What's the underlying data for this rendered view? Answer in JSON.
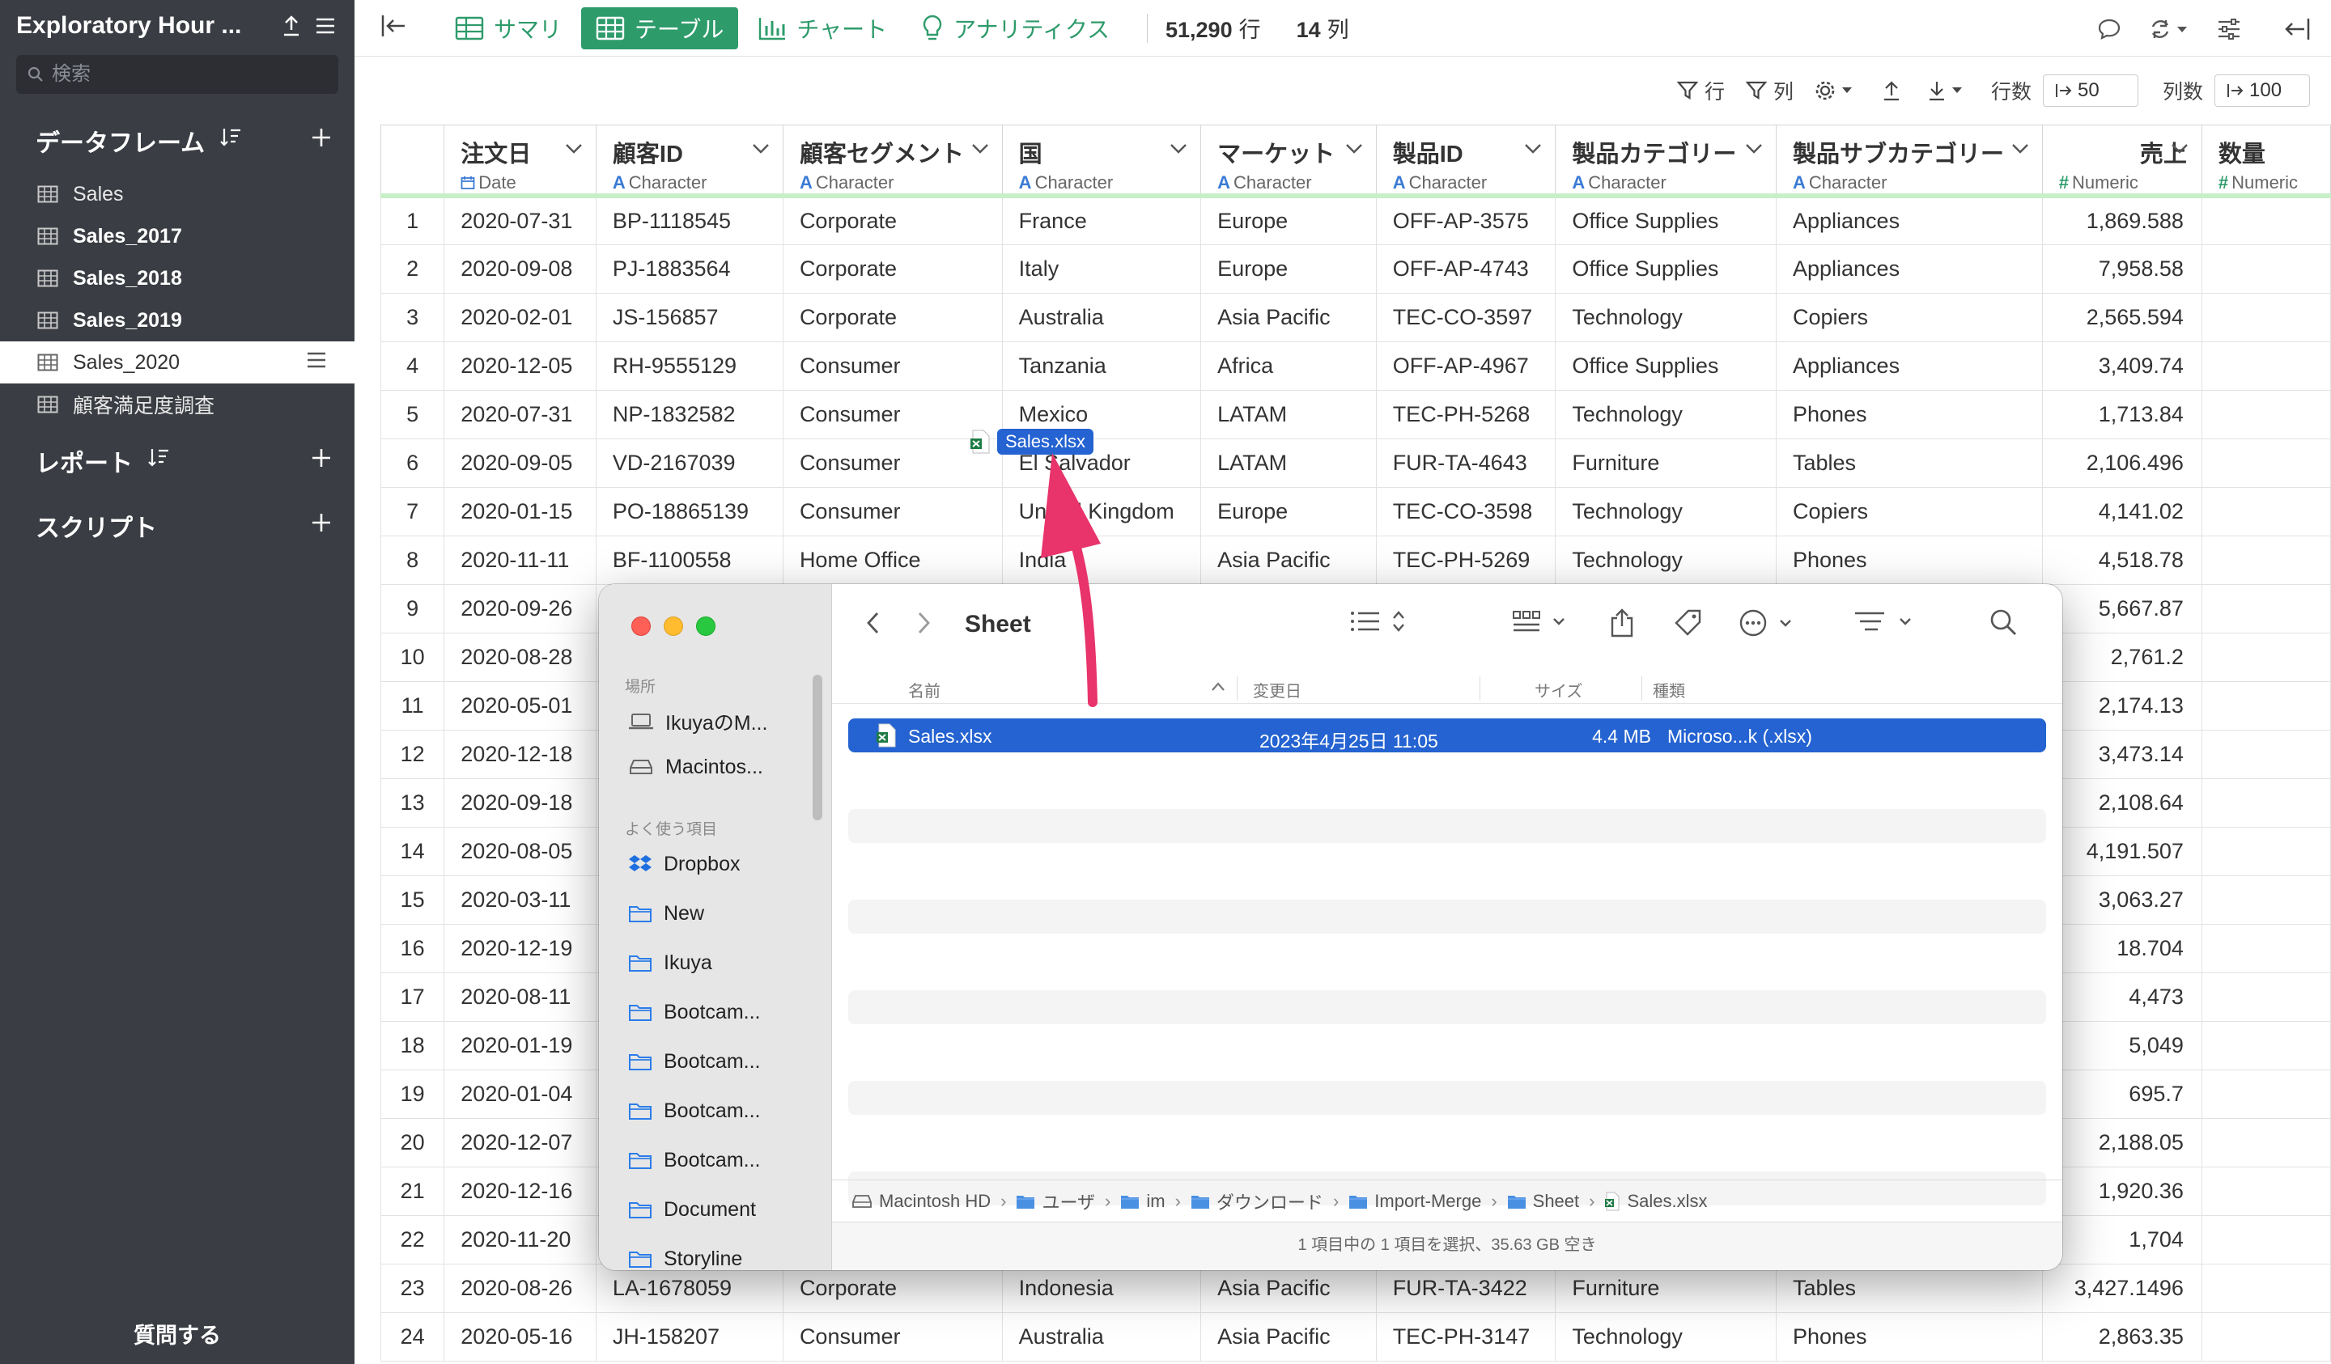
{
  "sidebar": {
    "title": "Exploratory Hour ...",
    "search_placeholder": "検索",
    "sections": {
      "dataframes": "データフレーム",
      "reports": "レポート",
      "scripts": "スクリプト"
    },
    "items": [
      {
        "label": "Sales",
        "bold": false,
        "active": false
      },
      {
        "label": "Sales_2017",
        "bold": true,
        "active": false
      },
      {
        "label": "Sales_2018",
        "bold": true,
        "active": false
      },
      {
        "label": "Sales_2019",
        "bold": true,
        "active": false
      },
      {
        "label": "Sales_2020",
        "bold": false,
        "active": true
      },
      {
        "label": "顧客満足度調査",
        "bold": false,
        "active": false
      }
    ],
    "ask": "質問する"
  },
  "topbar": {
    "tabs": [
      "サマリ",
      "テーブル",
      "チャート",
      "アナリティクス"
    ],
    "active_tab": "テーブル",
    "rows_count": "51,290",
    "rows_unit": "行",
    "cols_count": "14",
    "cols_unit": "列"
  },
  "toolbar2": {
    "row_filter": "行",
    "col_filter": "列",
    "rows_label": "行数",
    "rows_value": "50",
    "cols_label": "列数",
    "cols_value": "100"
  },
  "table": {
    "columns": [
      {
        "name": "注文日",
        "type": "Date",
        "type_icon": "calendar-icon"
      },
      {
        "name": "顧客ID",
        "type": "Character",
        "type_icon": "A"
      },
      {
        "name": "顧客セグメント",
        "type": "Character",
        "type_icon": "A"
      },
      {
        "name": "国",
        "type": "Character",
        "type_icon": "A"
      },
      {
        "name": "マーケット",
        "type": "Character",
        "type_icon": "A"
      },
      {
        "name": "製品ID",
        "type": "Character",
        "type_icon": "A"
      },
      {
        "name": "製品カテゴリー",
        "type": "Character",
        "type_icon": "A"
      },
      {
        "name": "製品サブカテゴリー",
        "type": "Character",
        "type_icon": "A"
      },
      {
        "name": "売上",
        "type": "Numeric",
        "type_icon": "#"
      },
      {
        "name": "数量",
        "type": "Numeric",
        "type_icon": "#"
      }
    ],
    "rows": [
      [
        "1",
        "2020-07-31",
        "BP-1118545",
        "Corporate",
        "France",
        "Europe",
        "OFF-AP-3575",
        "Office Supplies",
        "Appliances",
        "1,869.588"
      ],
      [
        "2",
        "2020-09-08",
        "PJ-1883564",
        "Corporate",
        "Italy",
        "Europe",
        "OFF-AP-4743",
        "Office Supplies",
        "Appliances",
        "7,958.58"
      ],
      [
        "3",
        "2020-02-01",
        "JS-156857",
        "Corporate",
        "Australia",
        "Asia Pacific",
        "TEC-CO-3597",
        "Technology",
        "Copiers",
        "2,565.594"
      ],
      [
        "4",
        "2020-12-05",
        "RH-9555129",
        "Consumer",
        "Tanzania",
        "Africa",
        "OFF-AP-4967",
        "Office Supplies",
        "Appliances",
        "3,409.74"
      ],
      [
        "5",
        "2020-07-31",
        "NP-1832582",
        "Consumer",
        "Mexico",
        "LATAM",
        "TEC-PH-5268",
        "Technology",
        "Phones",
        "1,713.84"
      ],
      [
        "6",
        "2020-09-05",
        "VD-2167039",
        "Consumer",
        "El Salvador",
        "LATAM",
        "FUR-TA-4643",
        "Furniture",
        "Tables",
        "2,106.496"
      ],
      [
        "7",
        "2020-01-15",
        "PO-18865139",
        "Consumer",
        "United Kingdom",
        "Europe",
        "TEC-CO-3598",
        "Technology",
        "Copiers",
        "4,141.02"
      ],
      [
        "8",
        "2020-11-11",
        "BF-1100558",
        "Home Office",
        "India",
        "Asia Pacific",
        "TEC-PH-5269",
        "Technology",
        "Phones",
        "4,518.78"
      ],
      [
        "9",
        "2020-09-26",
        "",
        "",
        "",
        "",
        "",
        "",
        "",
        "5,667.87"
      ],
      [
        "10",
        "2020-08-28",
        "",
        "",
        "",
        "",
        "",
        "",
        "",
        "2,761.2"
      ],
      [
        "11",
        "2020-05-01",
        "",
        "",
        "",
        "",
        "",
        "",
        "",
        "2,174.13"
      ],
      [
        "12",
        "2020-12-18",
        "",
        "",
        "",
        "",
        "",
        "",
        "",
        "3,473.14"
      ],
      [
        "13",
        "2020-09-18",
        "",
        "",
        "",
        "",
        "",
        "",
        "",
        "2,108.64"
      ],
      [
        "14",
        "2020-08-05",
        "",
        "",
        "",
        "",
        "",
        "",
        "",
        "4,191.507"
      ],
      [
        "15",
        "2020-03-11",
        "",
        "",
        "",
        "",
        "",
        "",
        "",
        "3,063.27"
      ],
      [
        "16",
        "2020-12-19",
        "",
        "",
        "",
        "",
        "",
        "",
        "",
        "18.704"
      ],
      [
        "17",
        "2020-08-11",
        "",
        "",
        "",
        "",
        "",
        "",
        "",
        "4,473"
      ],
      [
        "18",
        "2020-01-19",
        "",
        "",
        "",
        "",
        "",
        "",
        "",
        "5,049"
      ],
      [
        "19",
        "2020-01-04",
        "",
        "",
        "",
        "",
        "",
        "",
        "",
        "695.7"
      ],
      [
        "20",
        "2020-12-07",
        "",
        "",
        "",
        "",
        "",
        "",
        "",
        "2,188.05"
      ],
      [
        "21",
        "2020-12-16",
        "",
        "",
        "",
        "",
        "",
        "",
        "",
        "1,920.36"
      ],
      [
        "22",
        "2020-11-20",
        "",
        "",
        "",
        "",
        "",
        "",
        "",
        "1,704"
      ],
      [
        "23",
        "2020-08-26",
        "LA-1678059",
        "Corporate",
        "Indonesia",
        "Asia Pacific",
        "FUR-TA-3422",
        "Furniture",
        "Tables",
        "3,427.1496"
      ],
      [
        "24",
        "2020-05-16",
        "JH-158207",
        "Consumer",
        "Australia",
        "Asia Pacific",
        "TEC-PH-3147",
        "Technology",
        "Phones",
        "2,863.35"
      ]
    ]
  },
  "finder": {
    "title": "Sheet",
    "sidebar": {
      "places_header": "場所",
      "places": [
        "IkuyaのM...",
        "Macintos..."
      ],
      "favorites_header": "よく使う項目",
      "favorites": [
        "Dropbox",
        "New",
        "Ikuya",
        "Bootcam...",
        "Bootcam...",
        "Bootcam...",
        "Bootcam...",
        "Document",
        "Storyline"
      ]
    },
    "columns": {
      "name": "名前",
      "modified": "変更日",
      "size": "サイズ",
      "kind": "種類"
    },
    "file": {
      "name": "Sales.xlsx",
      "modified": "2023年4月25日 11:05",
      "size": "4.4 MB",
      "kind": "Microso...k (.xlsx)"
    },
    "path": [
      "Macintosh HD",
      "ユーザ",
      "im",
      "ダウンロード",
      "Import-Merge",
      "Sheet",
      "Sales.xlsx"
    ],
    "status": "1 項目中の 1 項目を選択、35.63 GB 空き"
  },
  "drag": {
    "filename": "Sales.xlsx"
  },
  "colors": {
    "accent": "#2e9b6b",
    "sidebar_bg": "#3a3d43",
    "selection": "#2463d1",
    "arrow": "#e8336b"
  }
}
